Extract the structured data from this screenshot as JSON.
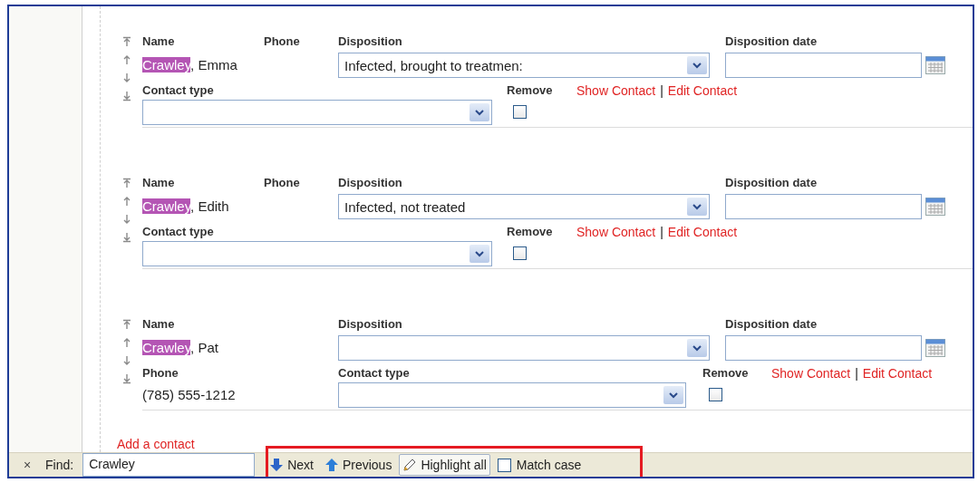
{
  "contacts": [
    {
      "kind": "phone_beside_name",
      "labels": {
        "name": "Name",
        "phone": "Phone",
        "disposition": "Disposition",
        "disposition_date": "Disposition date",
        "contact_type": "Contact type",
        "remove": "Remove"
      },
      "name": {
        "match": "Crawley",
        "rest": ", Emma"
      },
      "disposition": "Infected, brought to treatmen:",
      "remove_checked": false,
      "links": [
        "Show Contact",
        "Edit Contact"
      ],
      "link_separator": "|"
    },
    {
      "kind": "phone_beside_name",
      "labels": {
        "name": "Name",
        "phone": "Phone",
        "disposition": "Disposition",
        "disposition_date": "Disposition date",
        "contact_type": "Contact type",
        "remove": "Remove"
      },
      "name": {
        "match": "Crawley",
        "rest": ", Edith"
      },
      "disposition": "Infected, not treated",
      "remove_checked": false,
      "links": [
        "Show Contact",
        "Edit Contact"
      ],
      "link_separator": "|"
    },
    {
      "kind": "phone_below_name",
      "labels": {
        "name": "Name",
        "phone": "Phone",
        "disposition": "Disposition",
        "disposition_date": "Disposition date",
        "contact_type": "Contact type",
        "remove": "Remove"
      },
      "name": {
        "match": "Crawley",
        "rest": ", Pat"
      },
      "phone": "(785) 555-1212",
      "remove_checked": false,
      "links": [
        "Show Contact",
        "Edit Contact"
      ],
      "link_separator": "|"
    }
  ],
  "add_contact": "Add a contact",
  "find_bar": {
    "close": "×",
    "label": "Find:",
    "value": "Crawley",
    "buttons": [
      {
        "kind": "next",
        "label": "Next"
      },
      {
        "kind": "previous",
        "label": "Previous"
      },
      {
        "kind": "toggle",
        "label": "Highlight all",
        "selected": true
      }
    ],
    "match_case": {
      "label": "Match case",
      "checked": false
    }
  }
}
